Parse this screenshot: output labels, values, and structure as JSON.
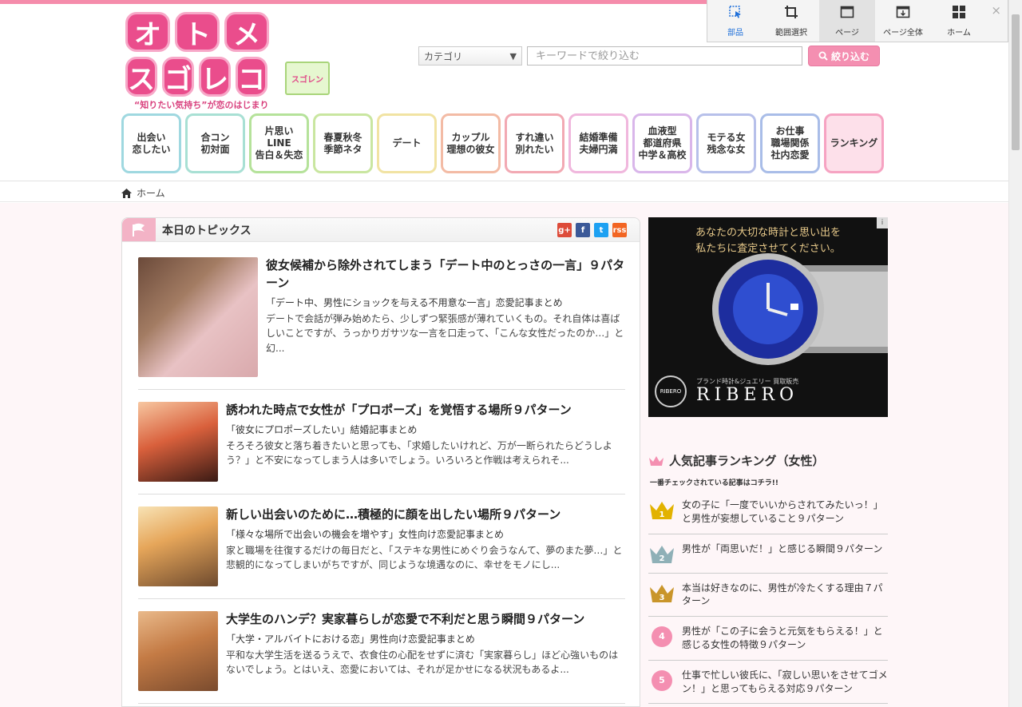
{
  "capture_toolbar": {
    "buttons": [
      {
        "label": "部品",
        "icon": "select-element-icon"
      },
      {
        "label": "範囲選択",
        "icon": "crop-icon"
      },
      {
        "label": "ページ",
        "icon": "page-icon"
      },
      {
        "label": "ページ全体",
        "icon": "full-page-icon"
      },
      {
        "label": "ホーム",
        "icon": "home-grid-icon"
      }
    ],
    "close": "×"
  },
  "header": {
    "logo_chars": [
      "オ",
      "ト",
      "メ",
      "ス",
      "ゴ",
      "レ",
      "コ"
    ],
    "tagline": "“知りたい気持ち”が恋のはじまり",
    "small_logo": "スゴレン",
    "category_select": "カテゴリ",
    "keyword_placeholder": "キーワードで絞り込む",
    "filter_button": "絞り込む"
  },
  "categories": [
    {
      "label": "出会い\n恋したい",
      "color": "#9fd8e0"
    },
    {
      "label": "合コン\n初対面",
      "color": "#a8e0d4"
    },
    {
      "label": "片思い\nLINE\n告白＆失恋",
      "color": "#b5e29a"
    },
    {
      "label": "春夏秋冬\n季節ネタ",
      "color": "#c9e6a0"
    },
    {
      "label": "デート",
      "color": "#f1e3a3"
    },
    {
      "label": "カップル\n理想の彼女",
      "color": "#f3bba5"
    },
    {
      "label": "すれ違い\n別れたい",
      "color": "#f2a9b3"
    },
    {
      "label": "結婚準備\n夫婦円満",
      "color": "#f0b7dd"
    },
    {
      "label": "血液型\n都道府県\n中学＆高校",
      "color": "#d9b6ea"
    },
    {
      "label": "モテる女\n残念な女",
      "color": "#b7c0ea"
    },
    {
      "label": "お仕事\n職場関係\n社内恋愛",
      "color": "#a9bde8"
    },
    {
      "label": "ランキング",
      "color": "#f6a3c2"
    }
  ],
  "breadcrumb": {
    "home": "ホーム"
  },
  "topics": {
    "title": "本日のトピックス",
    "social": [
      {
        "label": "g+",
        "color": "#dd4b39"
      },
      {
        "label": "f",
        "color": "#3b5998"
      },
      {
        "label": "t",
        "color": "#1da1f2"
      },
      {
        "label": "rss",
        "color": "#f26522"
      }
    ],
    "articles": [
      {
        "title": "彼女候補から除外されてしまう「デート中のとっさの一言」９パターン",
        "category": "「デート中、男性にショックを与える不用意な一言」恋愛記事まとめ",
        "desc": "デートで会話が弾み始めたら、少しずつ緊張感が薄れていくもの。それ自体は喜ばしいことですが、うっかりガサツな一言を口走って、「こんな女性だったのか…」と幻..."
      },
      {
        "title": "誘われた時点で女性が「プロポーズ」を覚悟する場所９パターン",
        "category": "「彼女にプロポーズしたい」結婚記事まとめ",
        "desc": "そろそろ彼女と落ち着きたいと思っても、「求婚したいけれど、万が一断られたらどうしよう？」と不安になってしまう人は多いでしょう。いろいろと作戦は考えられそ..."
      },
      {
        "title": "新しい出会いのために…積極的に顔を出したい場所９パターン",
        "category": "「様々な場所で出会いの機会を増やす」女性向け恋愛記事まとめ",
        "desc": "家と職場を往復するだけの毎日だと、「ステキな男性にめぐり会うなんて、夢のまた夢…」と悲観的になってしまいがちですが、同じような境遇なのに、幸せをモノにし..."
      },
      {
        "title": "大学生のハンデ？実家暮らしが恋愛で不利だと思う瞬間９パターン",
        "category": "「大学・アルバイトにおける恋」男性向け恋愛記事まとめ",
        "desc": "平和な大学生活を送るうえで、衣食住の心配をせずに済む「実家暮らし」ほど心強いものはないでしょう。とはいえ、恋愛においては、それが足かせになる状況もあるよ..."
      }
    ]
  },
  "ad": {
    "line1": "あなたの大切な時計と思い出を",
    "line2": "私たちに査定させてください。",
    "sub": "ブランド時計&ジュエリー 買取販売",
    "brand": "RIBERO",
    "badge": "RIBERO",
    "info": "i"
  },
  "ranking": {
    "title": "人気記事ランキング（女性）",
    "subtitle": "一番チェックされている記事はコチラ!!",
    "items": [
      {
        "rank": "1",
        "text": "女の子に「一度でいいからされてみたいっ！」と男性が妄想していること９パターン",
        "color": "#e2b200"
      },
      {
        "rank": "2",
        "text": "男性が「両思いだ！」と感じる瞬間９パターン",
        "color": "#8fb0b7"
      },
      {
        "rank": "3",
        "text": "本当は好きなのに、男性が冷たくする理由７パターン",
        "color": "#c9952a"
      },
      {
        "rank": "4",
        "text": "男性が「この子に会うと元気をもらえる！」と感じる女性の特徴９パターン",
        "color": "#f48fb1"
      },
      {
        "rank": "5",
        "text": "仕事で忙しい彼氏に、「寂しい思いをさせてゴメン！」と思ってもらえる対応９パターン",
        "color": "#f48fb1"
      }
    ]
  }
}
